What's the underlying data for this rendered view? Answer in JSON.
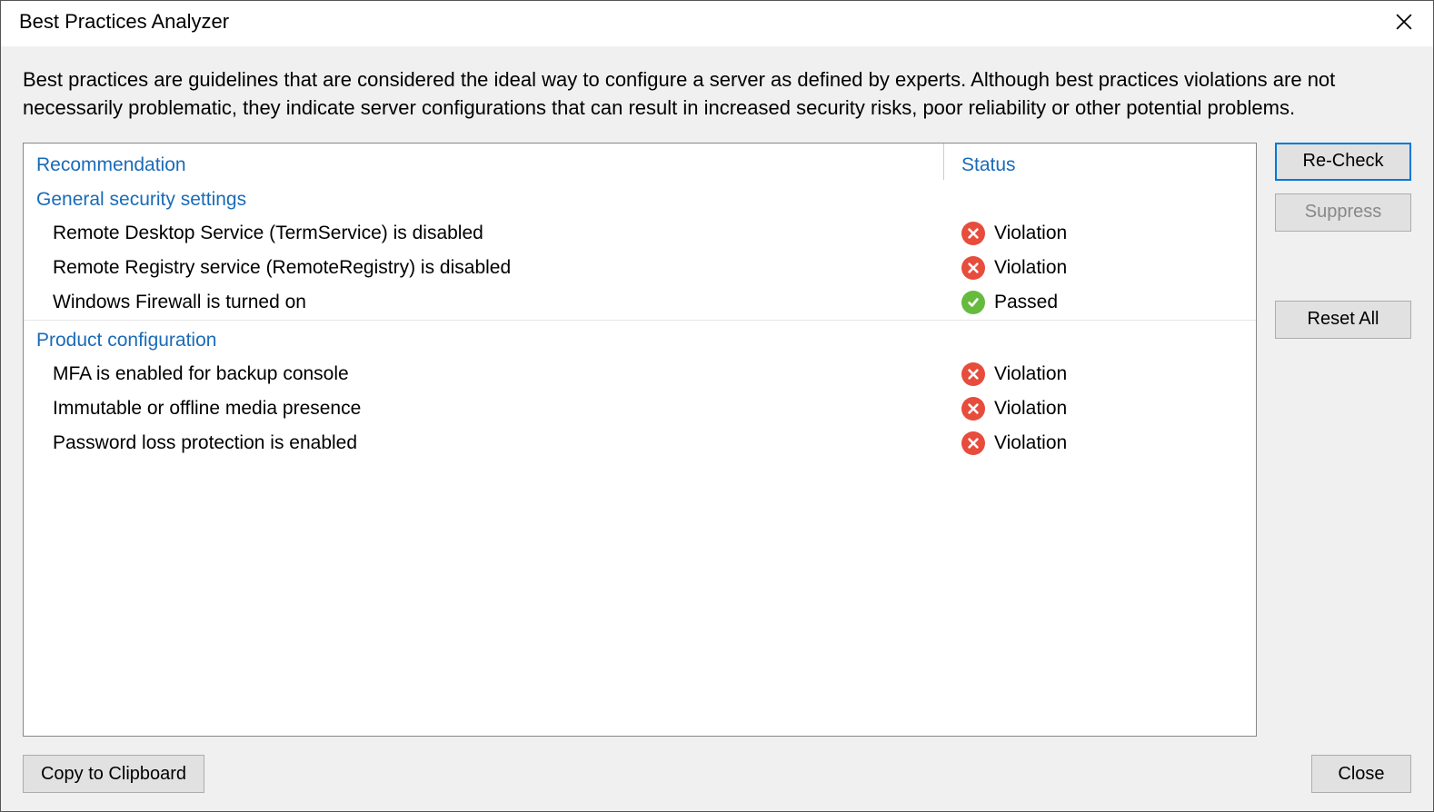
{
  "dialog": {
    "title": "Best Practices Analyzer",
    "description": "Best practices are guidelines that are considered the ideal way to configure a server as defined by experts. Although best practices violations are not necessarily problematic, they indicate server configurations that can result in increased security risks, poor reliability or other potential problems."
  },
  "columns": {
    "recommendation": "Recommendation",
    "status": "Status"
  },
  "groups": [
    {
      "name": "General security settings",
      "items": [
        {
          "recommendation": "Remote Desktop Service (TermService) is disabled",
          "status_label": "Violation",
          "status": "violation"
        },
        {
          "recommendation": "Remote Registry service (RemoteRegistry) is disabled",
          "status_label": "Violation",
          "status": "violation"
        },
        {
          "recommendation": "Windows Firewall is turned on",
          "status_label": "Passed",
          "status": "passed"
        }
      ]
    },
    {
      "name": "Product configuration",
      "items": [
        {
          "recommendation": "MFA is enabled for backup console",
          "status_label": "Violation",
          "status": "violation"
        },
        {
          "recommendation": "Immutable or offline media presence",
          "status_label": "Violation",
          "status": "violation"
        },
        {
          "recommendation": "Password loss protection is enabled",
          "status_label": "Violation",
          "status": "violation"
        }
      ]
    }
  ],
  "buttons": {
    "recheck": "Re-Check",
    "suppress": "Suppress",
    "reset_all": "Reset All",
    "copy_clipboard": "Copy to Clipboard",
    "close": "Close"
  }
}
